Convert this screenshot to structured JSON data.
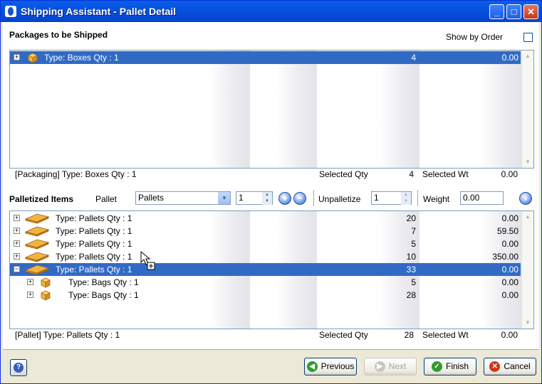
{
  "window": {
    "title": "Shipping Assistant - Pallet Detail"
  },
  "packages": {
    "section_label": "Packages to be Shipped",
    "show_by_order_label": "Show by Order",
    "rows": [
      {
        "label": "Type:  Boxes  Qty : 1",
        "qty": "4",
        "wt": "0.00"
      }
    ],
    "footer": {
      "label": "[Packaging]  Type:  Boxes  Qty : 1",
      "qty_label": "Selected Qty",
      "qty": "4",
      "wt_label": "Selected Wt",
      "wt": "0.00"
    }
  },
  "palletized": {
    "section_label": "Palletized Items",
    "pallet_label": "Pallet",
    "pallet_value": "Pallets",
    "pallet_count": "1",
    "unpalletize_label": "Unpalletize",
    "unpalletize_value": "1",
    "weight_label": "Weight",
    "weight_value": "0.00",
    "rows": [
      {
        "label": "Type:  Pallets  Qty : 1",
        "qty": "20",
        "wt": "0.00"
      },
      {
        "label": "Type:  Pallets  Qty : 1",
        "qty": "7",
        "wt": "59.50"
      },
      {
        "label": "Type:  Pallets  Qty : 1",
        "qty": "5",
        "wt": "0.00"
      },
      {
        "label": "Type:  Pallets  Qty : 1",
        "qty": "10",
        "wt": "350.00"
      },
      {
        "label": "Type:  Pallets  Qty : 1",
        "qty": "33",
        "wt": "0.00"
      },
      {
        "label": "Type:  Bags  Qty : 1",
        "qty": "5",
        "wt": "0.00"
      },
      {
        "label": "Type:  Bags  Qty : 1",
        "qty": "28",
        "wt": "0.00"
      }
    ],
    "footer": {
      "label": "[Pallet]  Type:  Pallets  Qty : 1",
      "qty_label": "Selected Qty",
      "qty": "28",
      "wt_label": "Selected Wt",
      "wt": "0.00"
    }
  },
  "buttons": {
    "previous": "Previous",
    "next": "Next",
    "finish": "Finish",
    "cancel": "Cancel"
  },
  "colors": {
    "selection": "#316ac5",
    "titlebar": "#0552de",
    "box_icon": "#f0b53c"
  }
}
